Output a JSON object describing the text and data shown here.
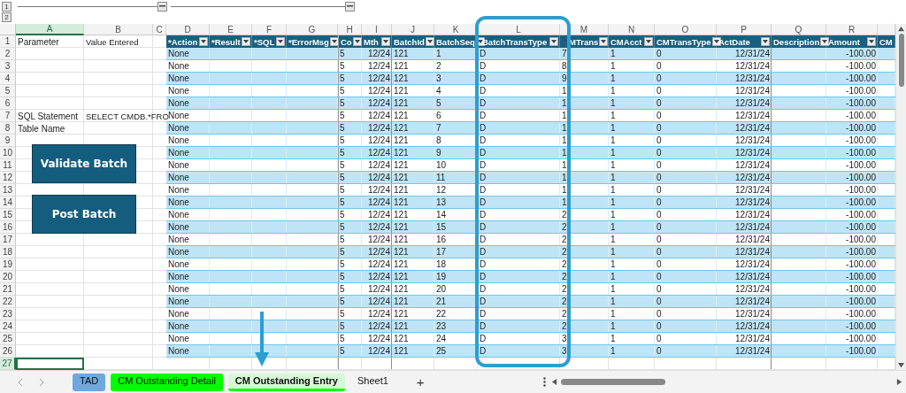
{
  "outline": {
    "levels": [
      "1",
      "2"
    ]
  },
  "column_letters": [
    {
      "label": "A",
      "selected": true
    },
    {
      "label": "B",
      "selected": false
    },
    {
      "label": "C",
      "selected": false
    },
    {
      "label": "D",
      "selected": false
    },
    {
      "label": "E",
      "selected": false
    },
    {
      "label": "F",
      "selected": false
    },
    {
      "label": "G",
      "selected": false
    },
    {
      "label": "H",
      "selected": false
    },
    {
      "label": "I",
      "selected": false
    },
    {
      "label": "J",
      "selected": false
    },
    {
      "label": "K",
      "selected": false
    },
    {
      "label": "L",
      "selected": false
    },
    {
      "label": "M",
      "selected": false
    },
    {
      "label": "N",
      "selected": false
    },
    {
      "label": "O",
      "selected": false
    },
    {
      "label": "P",
      "selected": false
    },
    {
      "label": "Q",
      "selected": false
    },
    {
      "label": "R",
      "selected": false
    }
  ],
  "sheet_rows": [
    {
      "number": "1",
      "selected": false,
      "a": "Parameter",
      "b": "Value Entered"
    },
    {
      "number": "2",
      "selected": false
    },
    {
      "number": "3",
      "selected": false
    },
    {
      "number": "4",
      "selected": false
    },
    {
      "number": "5",
      "selected": false
    },
    {
      "number": "6",
      "selected": false
    },
    {
      "number": "7",
      "selected": false,
      "a": "SQL Statement",
      "b": "SELECT CMDB.*FRO"
    },
    {
      "number": "8",
      "selected": false,
      "a": "Table Name"
    },
    {
      "number": "9",
      "selected": false
    },
    {
      "number": "10",
      "selected": false
    },
    {
      "number": "11",
      "selected": false
    },
    {
      "number": "12",
      "selected": false
    },
    {
      "number": "13",
      "selected": false
    },
    {
      "number": "14",
      "selected": false
    },
    {
      "number": "15",
      "selected": false
    },
    {
      "number": "16",
      "selected": false
    },
    {
      "number": "17",
      "selected": false
    },
    {
      "number": "18",
      "selected": false
    },
    {
      "number": "19",
      "selected": false
    },
    {
      "number": "20",
      "selected": false
    },
    {
      "number": "21",
      "selected": false
    },
    {
      "number": "22",
      "selected": false
    },
    {
      "number": "23",
      "selected": false
    },
    {
      "number": "24",
      "selected": false
    },
    {
      "number": "25",
      "selected": false
    },
    {
      "number": "26",
      "selected": false
    },
    {
      "number": "27",
      "selected": true
    }
  ],
  "table": {
    "columns": [
      "*Action",
      "*Result",
      "*SQL",
      "*ErrorMsg",
      "Co",
      "Mth",
      "BatchId",
      "BatchSeq",
      "BatchTransType",
      "MTrans",
      "CMAcct",
      "CMTransType",
      "ActDate",
      "Description",
      "Amount",
      "CM"
    ],
    "rows": [
      {
        "action": "None",
        "co": "5",
        "mth": "12/24",
        "batch_id": "121",
        "batch_seq": "1",
        "batch_trans_type": "D",
        "cm_trans": "7",
        "cm_acct": "1",
        "cm_trans_type": "0",
        "act_date": "12/31/24",
        "amount": "-100.00"
      },
      {
        "action": "None",
        "co": "5",
        "mth": "12/24",
        "batch_id": "121",
        "batch_seq": "2",
        "batch_trans_type": "D",
        "cm_trans": "8",
        "cm_acct": "1",
        "cm_trans_type": "0",
        "act_date": "12/31/24",
        "amount": "-100.00"
      },
      {
        "action": "None",
        "co": "5",
        "mth": "12/24",
        "batch_id": "121",
        "batch_seq": "3",
        "batch_trans_type": "D",
        "cm_trans": "9",
        "cm_acct": "1",
        "cm_trans_type": "0",
        "act_date": "12/31/24",
        "amount": "-100.00"
      },
      {
        "action": "None",
        "co": "5",
        "mth": "12/24",
        "batch_id": "121",
        "batch_seq": "4",
        "batch_trans_type": "D",
        "cm_trans": "1",
        "cm_acct": "1",
        "cm_trans_type": "0",
        "act_date": "12/31/24",
        "amount": "-100.00"
      },
      {
        "action": "None",
        "co": "5",
        "mth": "12/24",
        "batch_id": "121",
        "batch_seq": "5",
        "batch_trans_type": "D",
        "cm_trans": "1",
        "cm_acct": "1",
        "cm_trans_type": "0",
        "act_date": "12/31/24",
        "amount": "-100.00"
      },
      {
        "action": "None",
        "co": "5",
        "mth": "12/24",
        "batch_id": "121",
        "batch_seq": "6",
        "batch_trans_type": "D",
        "cm_trans": "1",
        "cm_acct": "1",
        "cm_trans_type": "0",
        "act_date": "12/31/24",
        "amount": "-100.00"
      },
      {
        "action": "None",
        "co": "5",
        "mth": "12/24",
        "batch_id": "121",
        "batch_seq": "7",
        "batch_trans_type": "D",
        "cm_trans": "1",
        "cm_acct": "1",
        "cm_trans_type": "0",
        "act_date": "12/31/24",
        "amount": "-100.00"
      },
      {
        "action": "None",
        "co": "5",
        "mth": "12/24",
        "batch_id": "121",
        "batch_seq": "8",
        "batch_trans_type": "D",
        "cm_trans": "1",
        "cm_acct": "1",
        "cm_trans_type": "0",
        "act_date": "12/31/24",
        "amount": "-100.00"
      },
      {
        "action": "None",
        "co": "5",
        "mth": "12/24",
        "batch_id": "121",
        "batch_seq": "9",
        "batch_trans_type": "D",
        "cm_trans": "1",
        "cm_acct": "1",
        "cm_trans_type": "0",
        "act_date": "12/31/24",
        "amount": "-100.00"
      },
      {
        "action": "None",
        "co": "5",
        "mth": "12/24",
        "batch_id": "121",
        "batch_seq": "10",
        "batch_trans_type": "D",
        "cm_trans": "1",
        "cm_acct": "1",
        "cm_trans_type": "0",
        "act_date": "12/31/24",
        "amount": "-100.00"
      },
      {
        "action": "None",
        "co": "5",
        "mth": "12/24",
        "batch_id": "121",
        "batch_seq": "11",
        "batch_trans_type": "D",
        "cm_trans": "1",
        "cm_acct": "1",
        "cm_trans_type": "0",
        "act_date": "12/31/24",
        "amount": "-100.00"
      },
      {
        "action": "None",
        "co": "5",
        "mth": "12/24",
        "batch_id": "121",
        "batch_seq": "12",
        "batch_trans_type": "D",
        "cm_trans": "1",
        "cm_acct": "1",
        "cm_trans_type": "0",
        "act_date": "12/31/24",
        "amount": "-100.00"
      },
      {
        "action": "None",
        "co": "5",
        "mth": "12/24",
        "batch_id": "121",
        "batch_seq": "13",
        "batch_trans_type": "D",
        "cm_trans": "1",
        "cm_acct": "1",
        "cm_trans_type": "0",
        "act_date": "12/31/24",
        "amount": "-100.00"
      },
      {
        "action": "None",
        "co": "5",
        "mth": "12/24",
        "batch_id": "121",
        "batch_seq": "14",
        "batch_trans_type": "D",
        "cm_trans": "2",
        "cm_acct": "1",
        "cm_trans_type": "0",
        "act_date": "12/31/24",
        "amount": "-100.00"
      },
      {
        "action": "None",
        "co": "5",
        "mth": "12/24",
        "batch_id": "121",
        "batch_seq": "15",
        "batch_trans_type": "D",
        "cm_trans": "2",
        "cm_acct": "1",
        "cm_trans_type": "0",
        "act_date": "12/31/24",
        "amount": "-100.00"
      },
      {
        "action": "None",
        "co": "5",
        "mth": "12/24",
        "batch_id": "121",
        "batch_seq": "16",
        "batch_trans_type": "D",
        "cm_trans": "2",
        "cm_acct": "1",
        "cm_trans_type": "0",
        "act_date": "12/31/24",
        "amount": "-100.00"
      },
      {
        "action": "None",
        "co": "5",
        "mth": "12/24",
        "batch_id": "121",
        "batch_seq": "17",
        "batch_trans_type": "D",
        "cm_trans": "2",
        "cm_acct": "1",
        "cm_trans_type": "0",
        "act_date": "12/31/24",
        "amount": "-100.00"
      },
      {
        "action": "None",
        "co": "5",
        "mth": "12/24",
        "batch_id": "121",
        "batch_seq": "18",
        "batch_trans_type": "D",
        "cm_trans": "2",
        "cm_acct": "1",
        "cm_trans_type": "0",
        "act_date": "12/31/24",
        "amount": "-100.00"
      },
      {
        "action": "None",
        "co": "5",
        "mth": "12/24",
        "batch_id": "121",
        "batch_seq": "19",
        "batch_trans_type": "D",
        "cm_trans": "2",
        "cm_acct": "1",
        "cm_trans_type": "0",
        "act_date": "12/31/24",
        "amount": "-100.00"
      },
      {
        "action": "None",
        "co": "5",
        "mth": "12/24",
        "batch_id": "121",
        "batch_seq": "20",
        "batch_trans_type": "D",
        "cm_trans": "2",
        "cm_acct": "1",
        "cm_trans_type": "0",
        "act_date": "12/31/24",
        "amount": "-100.00"
      },
      {
        "action": "None",
        "co": "5",
        "mth": "12/24",
        "batch_id": "121",
        "batch_seq": "21",
        "batch_trans_type": "D",
        "cm_trans": "2",
        "cm_acct": "1",
        "cm_trans_type": "0",
        "act_date": "12/31/24",
        "amount": "-100.00"
      },
      {
        "action": "None",
        "co": "5",
        "mth": "12/24",
        "batch_id": "121",
        "batch_seq": "22",
        "batch_trans_type": "D",
        "cm_trans": "2",
        "cm_acct": "1",
        "cm_trans_type": "0",
        "act_date": "12/31/24",
        "amount": "-100.00"
      },
      {
        "action": "None",
        "co": "5",
        "mth": "12/24",
        "batch_id": "121",
        "batch_seq": "23",
        "batch_trans_type": "D",
        "cm_trans": "2",
        "cm_acct": "1",
        "cm_trans_type": "0",
        "act_date": "12/31/24",
        "amount": "-100.00"
      },
      {
        "action": "None",
        "co": "5",
        "mth": "12/24",
        "batch_id": "121",
        "batch_seq": "24",
        "batch_trans_type": "D",
        "cm_trans": "3",
        "cm_acct": "1",
        "cm_trans_type": "0",
        "act_date": "12/31/24",
        "amount": "-100.00"
      },
      {
        "action": "None",
        "co": "5",
        "mth": "12/24",
        "batch_id": "121",
        "batch_seq": "25",
        "batch_trans_type": "D",
        "cm_trans": "3",
        "cm_acct": "1",
        "cm_trans_type": "0",
        "act_date": "12/31/24",
        "amount": "-100.00"
      }
    ]
  },
  "buttons": [
    {
      "label": "Validate Batch"
    },
    {
      "label": "Post Batch"
    }
  ],
  "sheet_tabs": [
    {
      "label": "TAD",
      "color": "#6fa8dc",
      "selected": false
    },
    {
      "label": "CM Outstanding Detail",
      "color": "#00ff00",
      "selected": false
    },
    {
      "label": "CM Outstanding Entry",
      "color": "#00ff00",
      "selected": true
    },
    {
      "label": "Sheet1",
      "selected": false
    }
  ],
  "new_sheet": {
    "label": "+"
  }
}
